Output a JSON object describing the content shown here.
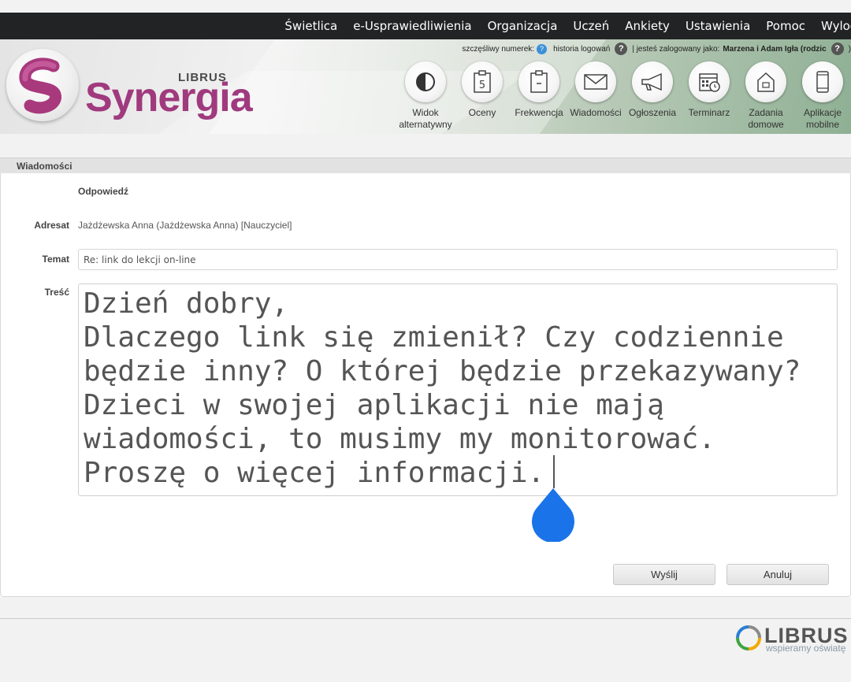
{
  "nav": {
    "items": [
      "Świetlica",
      "e-Usprawiedliwienia",
      "Organizacja",
      "Uczeń",
      "Ankiety",
      "Ustawienia",
      "Pomoc",
      "Wyloguj"
    ]
  },
  "brand": {
    "small": "LIBRUS",
    "big": "Synergia"
  },
  "userline": {
    "lucky_number_label": "szczęśliwy numerek:",
    "lucky_number_value": "?",
    "history_label": "historia logowań",
    "logged_as_label": "| jesteś zalogowany jako:",
    "user": "Marzena i Adam Igła (rodzic",
    "trailing": ")"
  },
  "iconbar": [
    {
      "label": "Widok alternatywny",
      "icon": "half-circle-icon"
    },
    {
      "label": "Oceny",
      "icon": "grade-icon"
    },
    {
      "label": "Frekwencja",
      "icon": "clipboard-icon"
    },
    {
      "label": "Wiadomości",
      "icon": "envelope-icon"
    },
    {
      "label": "Ogłoszenia",
      "icon": "megaphone-icon"
    },
    {
      "label": "Terminarz",
      "icon": "calendar-icon"
    },
    {
      "label": "Zadania domowe",
      "icon": "house-icon"
    },
    {
      "label": "Aplikacje mobilne",
      "icon": "phone-icon"
    }
  ],
  "panel": {
    "title": "Wiadomości",
    "section_heading": "Odpowiedź"
  },
  "form": {
    "adresat_label": "Adresat",
    "adresat_value": "Jażdżewska Anna (Jażdżewska Anna) [Nauczyciel]",
    "temat_label": "Temat",
    "temat_value": "Re: link do lekcji on-line",
    "tresc_label": "Treść",
    "tresc_value": "Dzień dobry,\nDlaczego link się zmienił? Czy codziennie będzie inny? O której będzie przekazywany? Dzieci w swojej aplikacji nie mają wiadomości, to musimy my monitorować. Proszę o więcej informacji."
  },
  "buttons": {
    "send": "Wyślij",
    "cancel": "Anuluj"
  },
  "footer": {
    "brand": "LIBRUS",
    "tagline": "wspieramy oświatę"
  },
  "colors": {
    "nav_bg": "#222324",
    "brand": "#a03a7e",
    "caret_drop": "#1a73e8"
  }
}
